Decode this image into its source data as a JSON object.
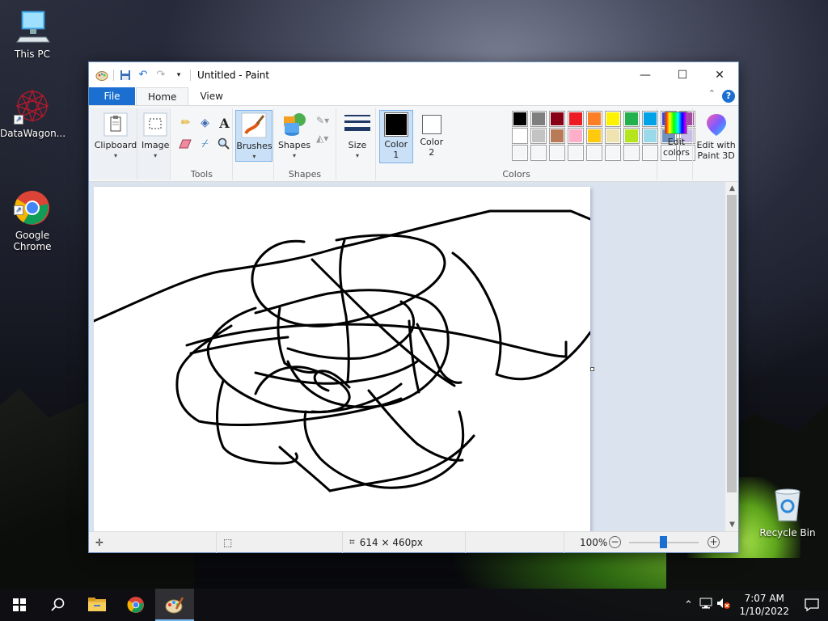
{
  "desktop": {
    "icons": [
      {
        "label": "This PC",
        "icon": "computer-icon"
      },
      {
        "label": "DataWagon...",
        "icon": "datawagon-icon"
      },
      {
        "label": "Google\nChrome",
        "icon": "chrome-icon"
      },
      {
        "label": "Recycle Bin",
        "icon": "recycle-bin-icon"
      }
    ]
  },
  "window": {
    "title": "Untitled - Paint",
    "controls": {
      "minimize": "—",
      "maximize": "☐",
      "close": "✕"
    }
  },
  "tabs": {
    "file": "File",
    "home": "Home",
    "view": "View",
    "help": "?"
  },
  "ribbon": {
    "clipboard": {
      "label": "Clipboard"
    },
    "image": {
      "label": "Image"
    },
    "tools": {
      "label": "Tools"
    },
    "brushes": {
      "label": "Brushes"
    },
    "shapes": {
      "label": "Shapes",
      "group_label": "Shapes"
    },
    "size": {
      "label": "Size"
    },
    "color1": {
      "label": "Color",
      "num": "1",
      "value": "#000000"
    },
    "color2": {
      "label": "Color",
      "num": "2",
      "value": "#ffffff"
    },
    "colors_group_label": "Colors",
    "edit_colors": {
      "line1": "Edit",
      "line2": "colors"
    },
    "paint3d": {
      "line1": "Edit with",
      "line2": "Paint 3D"
    },
    "palette": [
      "#000000",
      "#7f7f7f",
      "#880015",
      "#ed1c24",
      "#ff7f27",
      "#fff200",
      "#22b14c",
      "#00a2e8",
      "#3f48cc",
      "#a349a4",
      "#ffffff",
      "#c3c3c3",
      "#b97a57",
      "#ffaec9",
      "#ffc90e",
      "#efe4b0",
      "#b5e61d",
      "#99d9ea",
      "#7092be",
      "#c8bfe7",
      "#f5f6f7",
      "#f5f6f7",
      "#f5f6f7",
      "#f5f6f7",
      "#f5f6f7",
      "#f5f6f7",
      "#f5f6f7",
      "#f5f6f7",
      "#f5f6f7",
      "#f5f6f7"
    ]
  },
  "status": {
    "canvas_size": "614 × 460px",
    "zoom": "100%"
  },
  "taskbar": {
    "time": "7:07 AM",
    "date": "1/10/2022"
  }
}
